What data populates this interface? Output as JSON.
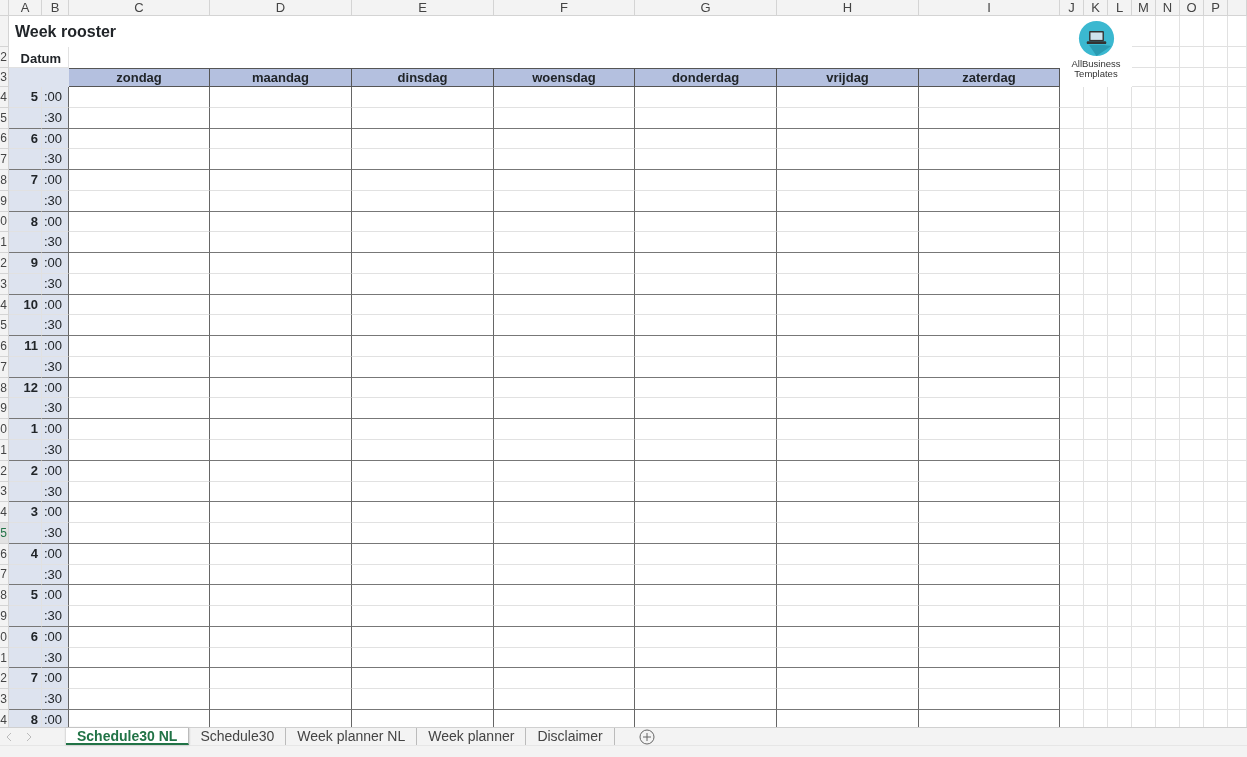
{
  "columns": [
    "A",
    "B",
    "C",
    "D",
    "E",
    "F",
    "G",
    "H",
    "I",
    "J",
    "K",
    "L",
    "M",
    "N",
    "O",
    "P"
  ],
  "row_numbers": [
    {
      "label": "2",
      "selected": false
    },
    {
      "label": "3",
      "selected": false
    },
    {
      "label": "4",
      "selected": false
    },
    {
      "label": "5",
      "selected": false
    },
    {
      "label": "6",
      "selected": false
    },
    {
      "label": "7",
      "selected": false
    },
    {
      "label": "8",
      "selected": false
    },
    {
      "label": "9",
      "selected": false
    },
    {
      "label": "0",
      "selected": false
    },
    {
      "label": "1",
      "selected": false
    },
    {
      "label": "2",
      "selected": false
    },
    {
      "label": "3",
      "selected": false
    },
    {
      "label": "4",
      "selected": false
    },
    {
      "label": "5",
      "selected": false
    },
    {
      "label": "6",
      "selected": false
    },
    {
      "label": "7",
      "selected": false
    },
    {
      "label": "8",
      "selected": false
    },
    {
      "label": "9",
      "selected": false
    },
    {
      "label": "0",
      "selected": false
    },
    {
      "label": "1",
      "selected": false
    },
    {
      "label": "2",
      "selected": false
    },
    {
      "label": "3",
      "selected": false
    },
    {
      "label": "4",
      "selected": false
    },
    {
      "label": "5",
      "selected": true
    },
    {
      "label": "6",
      "selected": false
    },
    {
      "label": "7",
      "selected": false
    },
    {
      "label": "8",
      "selected": false
    },
    {
      "label": "9",
      "selected": false
    },
    {
      "label": "0",
      "selected": false
    },
    {
      "label": "1",
      "selected": false
    },
    {
      "label": "2",
      "selected": false
    },
    {
      "label": "3",
      "selected": false
    },
    {
      "label": "4",
      "selected": false
    }
  ],
  "sheet_title": "Week rooster",
  "date_label": "Datum",
  "days": [
    "zondag",
    "maandag",
    "dinsdag",
    "woensdag",
    "donderdag",
    "vrijdag",
    "zaterdag"
  ],
  "time_rows": [
    {
      "hour": "5",
      "minute": ":00"
    },
    {
      "minute": ":30"
    },
    {
      "hour": "6",
      "minute": ":00"
    },
    {
      "minute": ":30"
    },
    {
      "hour": "7",
      "minute": ":00"
    },
    {
      "minute": ":30"
    },
    {
      "hour": "8",
      "minute": ":00"
    },
    {
      "minute": ":30"
    },
    {
      "hour": "9",
      "minute": ":00"
    },
    {
      "minute": ":30"
    },
    {
      "hour": "10",
      "minute": ":00"
    },
    {
      "minute": ":30"
    },
    {
      "hour": "11",
      "minute": ":00"
    },
    {
      "minute": ":30"
    },
    {
      "hour": "12",
      "minute": ":00"
    },
    {
      "minute": ":30"
    },
    {
      "hour": "1",
      "minute": ":00"
    },
    {
      "minute": ":30"
    },
    {
      "hour": "2",
      "minute": ":00"
    },
    {
      "minute": ":30"
    },
    {
      "hour": "3",
      "minute": ":00"
    },
    {
      "minute": ":30"
    },
    {
      "hour": "4",
      "minute": ":00"
    },
    {
      "minute": ":30"
    },
    {
      "hour": "5",
      "minute": ":00"
    },
    {
      "minute": ":30"
    },
    {
      "hour": "6",
      "minute": ":00"
    },
    {
      "minute": ":30"
    },
    {
      "hour": "7",
      "minute": ":00"
    },
    {
      "minute": ":30"
    },
    {
      "hour": "8",
      "minute": ":00"
    }
  ],
  "logo": {
    "text": "AllBusiness Templates"
  },
  "sheet_tabs": [
    {
      "label": "Schedule30 NL",
      "selected": true
    },
    {
      "label": "Schedule30",
      "selected": false
    },
    {
      "label": "Week planner NL",
      "selected": false
    },
    {
      "label": "Week planner",
      "selected": false
    },
    {
      "label": "Disclaimer",
      "selected": false
    }
  ]
}
